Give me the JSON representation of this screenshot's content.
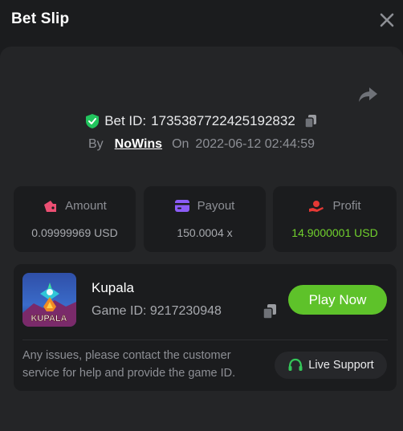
{
  "header": {
    "title": "Bet Slip"
  },
  "bet": {
    "id_label": "Bet ID:",
    "id_value": "1735387722425192832",
    "by_label": "By",
    "user": "NoWins",
    "on_label": "On",
    "datetime": "2022-06-12 02:44:59"
  },
  "stats": {
    "amount": {
      "label": "Amount",
      "value": "0.09999969 USD"
    },
    "payout": {
      "label": "Payout",
      "value": "150.0004 x"
    },
    "profit": {
      "label": "Profit",
      "value": "14.9000001 USD"
    }
  },
  "game": {
    "name": "Kupala",
    "id_text": "Game ID: 9217230948",
    "thumb_text": "KUPALA",
    "play_label": "Play Now",
    "issues_text": "Any issues, please contact the customer service for help and provide the game ID.",
    "support_label": "Live Support"
  },
  "colors": {
    "background": "#1b1c1e",
    "panel": "#242527",
    "accent_green": "#5ec22a",
    "profit_green": "#71d12d",
    "shield_green": "#22c55e",
    "amount_icon": "#ec4f73",
    "payout_icon": "#8b5cf6",
    "profit_icon": "#e53935"
  },
  "icons": {
    "close": "close-icon",
    "share": "share-icon",
    "shield": "shield-check-icon",
    "copy": "copy-icon",
    "amount": "wallet-icon",
    "payout": "card-icon",
    "profit": "profit-hand-icon",
    "support": "headset-icon"
  }
}
